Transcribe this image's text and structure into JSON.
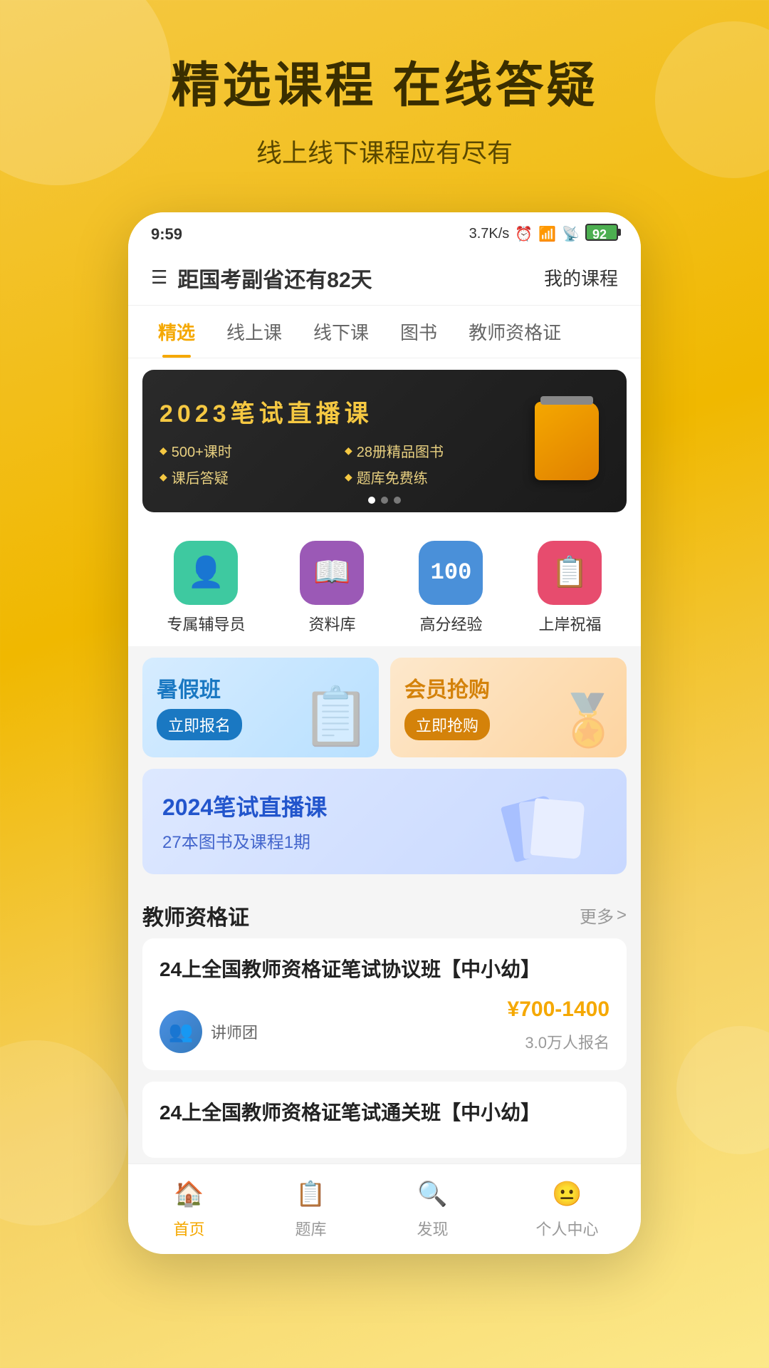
{
  "hero": {
    "title": "精选课程 在线答疑",
    "subtitle": "线上线下课程应有尽有"
  },
  "statusBar": {
    "time": "9:59",
    "network": "3.7K/s",
    "battery": "92"
  },
  "navbar": {
    "countdown": "距国考副省还有82天",
    "myCoursesLabel": "我的课程"
  },
  "tabs": [
    {
      "label": "精选",
      "active": true
    },
    {
      "label": "线上课",
      "active": false
    },
    {
      "label": "线下课",
      "active": false
    },
    {
      "label": "图书",
      "active": false
    },
    {
      "label": "教师资格证",
      "active": false
    }
  ],
  "banner": {
    "title": "2023笔试直播课",
    "features": [
      "500+课时",
      "28册精品图书",
      "课后答疑",
      "题库免费练"
    ],
    "dots": [
      true,
      false,
      false
    ]
  },
  "quickActions": [
    {
      "label": "专属辅导员",
      "icon": "👤",
      "color": "green"
    },
    {
      "label": "资料库",
      "icon": "📖",
      "color": "purple"
    },
    {
      "label": "高分经验",
      "icon": "💯",
      "color": "blue"
    },
    {
      "label": "上岸祝福",
      "icon": "📋",
      "color": "pink"
    }
  ],
  "promoCards": [
    {
      "title": "暑假班",
      "subtitle": "立即报名",
      "type": "blue"
    },
    {
      "title": "会员抢购",
      "subtitle": "立即抢购",
      "type": "orange"
    }
  ],
  "featuredCourse": {
    "title": "2024笔试直播课",
    "desc": "27本图书及课程1期"
  },
  "teacherCertSection": {
    "title": "教师资格证",
    "moreLabel": "更多"
  },
  "courses": [
    {
      "title": "24上全国教师资格证笔试协议班【中小幼】",
      "teacherLabel": "讲师团",
      "price": "¥700-1400",
      "enrollment": "3.0万人报名"
    },
    {
      "title": "24上全国教师资格证笔试通关班【中小幼】",
      "teacherLabel": "",
      "price": "",
      "enrollment": ""
    }
  ],
  "bottomNav": [
    {
      "label": "首页",
      "icon": "🏠",
      "active": true
    },
    {
      "label": "题库",
      "icon": "📋",
      "active": false
    },
    {
      "label": "发现",
      "icon": "🔍",
      "active": false
    },
    {
      "label": "个人中心",
      "icon": "😐",
      "active": false
    }
  ]
}
